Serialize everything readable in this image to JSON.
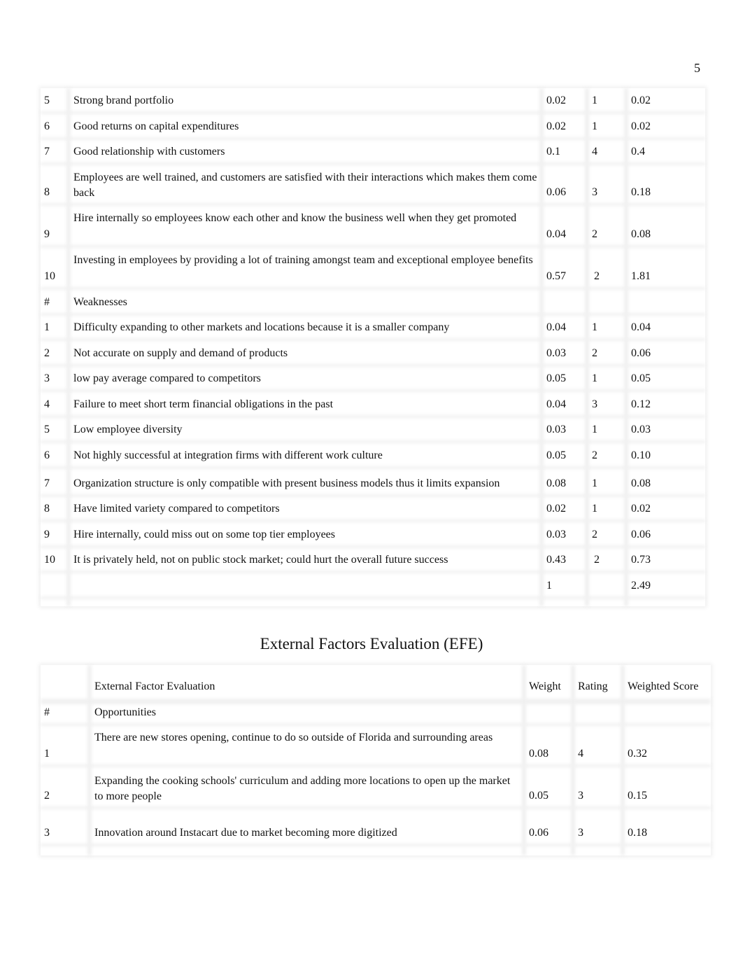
{
  "page_number": "5",
  "ife_table": {
    "rows": [
      {
        "num": "5",
        "text": "Strong brand portfolio",
        "weight": "0.02",
        "rating": "1",
        "score": "0.02"
      },
      {
        "num": "6",
        "text": "Good returns on capital expenditures",
        "weight": "0.02",
        "rating": "1",
        "score": "0.02"
      },
      {
        "num": "7",
        "text": "Good relationship with customers",
        "weight": "0.1",
        "rating": "4",
        "score": "0.4"
      },
      {
        "num": "8",
        "text": "Employees are well trained, and customers are satisfied with their interactions which makes them come back",
        "weight": "0.06",
        "rating": "3",
        "score": "0.18"
      },
      {
        "num": "9",
        "text": "Hire internally so employees know each other and know the business well when they get promoted",
        "weight": "0.04",
        "rating": "2",
        "score": "0.08"
      },
      {
        "num": "10",
        "text": "Investing in employees by providing a lot of training amongst team and exceptional employee benefits",
        "weight": "0.57",
        "rating": "2",
        "score": "1.81"
      },
      {
        "num": "#",
        "text": "Weaknesses",
        "weight": "",
        "rating": "",
        "score": ""
      },
      {
        "num": "1",
        "text": "Difficulty expanding to other markets and locations because it is a smaller company",
        "weight": "0.04",
        "rating": "1",
        "score": "0.04"
      },
      {
        "num": "2",
        "text": "Not accurate on supply and demand of products",
        "weight": "0.03",
        "rating": "2",
        "score": "0.06"
      },
      {
        "num": "3",
        "text": "low pay average compared to competitors",
        "weight": "0.05",
        "rating": "1",
        "score": "0.05"
      },
      {
        "num": "4",
        "text": "Failure to meet short term financial obligations in the past",
        "weight": "0.04",
        "rating": "3",
        "score": "0.12"
      },
      {
        "num": "5",
        "text": "Low employee diversity",
        "weight": "0.03",
        "rating": "1",
        "score": "0.03"
      },
      {
        "num": "6",
        "text": "Not highly successful at integration firms with different work culture",
        "weight": "0.05",
        "rating": "2",
        "score": "0.10"
      },
      {
        "num": "7",
        "text": "Organization structure is only compatible with present business models thus it limits expansion",
        "weight": "0.08",
        "rating": "1",
        "score": "0.08"
      },
      {
        "num": "8",
        "text": "Have limited variety compared to competitors",
        "weight": "0.02",
        "rating": "1",
        "score": "0.02"
      },
      {
        "num": "9",
        "text": "Hire internally, could miss out on some top tier employees",
        "weight": "0.03",
        "rating": "2",
        "score": "0.06"
      },
      {
        "num": "10",
        "text": "It is privately held, not on public stock market; could hurt the overall future success",
        "weight": "0.43",
        "rating": "2",
        "score": "0.73"
      },
      {
        "num": "",
        "text": "",
        "weight": "1",
        "rating": "",
        "score": "2.49"
      }
    ]
  },
  "efe": {
    "title": "External Factors Evaluation (EFE)",
    "header": {
      "num": "",
      "text": "External Factor Evaluation",
      "weight": "Weight",
      "rating": "Rating",
      "score": "Weighted Score"
    },
    "rows": [
      {
        "num": "#",
        "text": "Opportunities",
        "weight": "",
        "rating": "",
        "score": ""
      },
      {
        "num": "1",
        "text": "There are new stores opening, continue to do so outside of Florida and surrounding areas",
        "weight": "0.08",
        "rating": "4",
        "score": "0.32"
      },
      {
        "num": "2",
        "text": "Expanding the cooking schools' curriculum and adding more locations to open up the market to more people",
        "weight": "0.05",
        "rating": "3",
        "score": "0.15"
      },
      {
        "num": "3",
        "text": "Innovation around Instacart due to market becoming more digitized",
        "weight": "0.06",
        "rating": "3",
        "score": "0.18"
      }
    ]
  }
}
